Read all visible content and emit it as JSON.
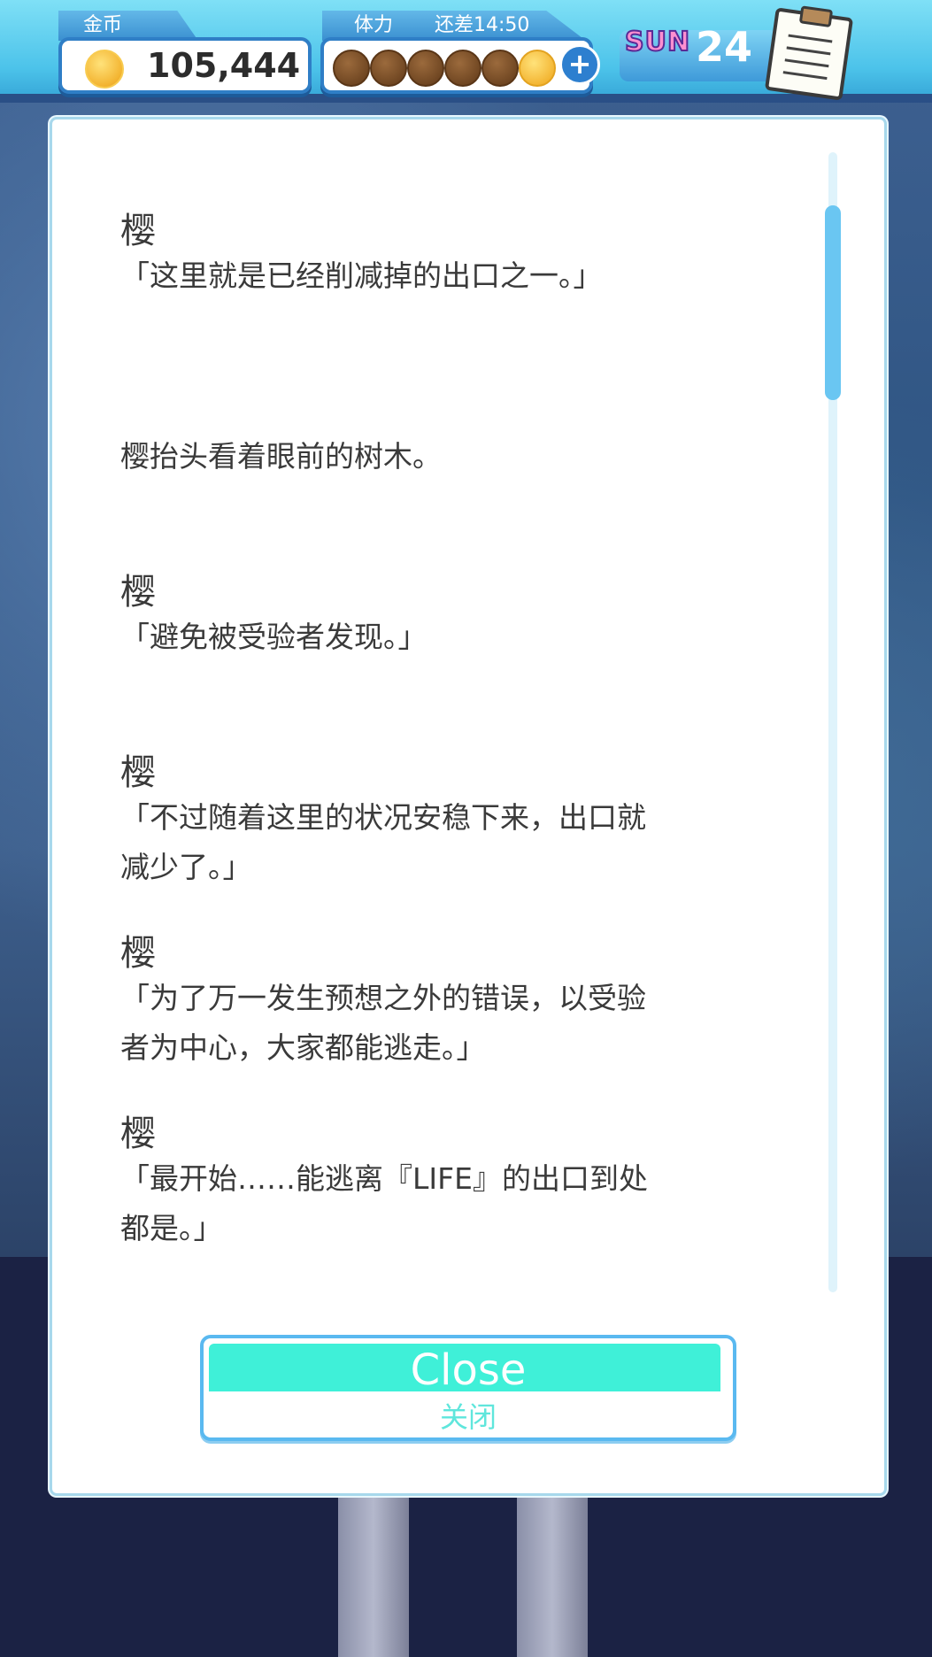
{
  "hud": {
    "coins": {
      "label": "金币",
      "value": "105,444"
    },
    "stamina": {
      "label": "体力",
      "timer": "还差14:50",
      "current": 1,
      "max": 6,
      "add_label": "+"
    },
    "calendar": {
      "day_name": "SUN",
      "day_number": "24"
    },
    "icons": {
      "coin": "coin-icon",
      "stamina": "stamina-face-icon",
      "notes": "notepad-icon"
    }
  },
  "log": {
    "entries": [
      {
        "speaker": "樱",
        "lines": [
          "「这里就是已经削减掉的出口之一。」"
        ]
      },
      {
        "speaker": "",
        "lines": [
          "樱抬头看着眼前的树木。"
        ]
      },
      {
        "speaker": "樱",
        "lines": [
          "「避免被受验者发现。」"
        ]
      },
      {
        "speaker": "樱",
        "lines": [
          "「不过随着这里的状况安稳下来，出口就",
          "减少了。」"
        ]
      },
      {
        "speaker": "樱",
        "lines": [
          "「为了万一发生预想之外的错误，以受验",
          "者为中心，大家都能逃走。」"
        ]
      },
      {
        "speaker": "樱",
        "lines": [
          "「最开始……能逃离『LIFE』的出口到处",
          "都是。」"
        ]
      }
    ],
    "scroll_position": 0.07
  },
  "close_button": {
    "label": "Close",
    "sublabel": "关闭"
  },
  "colors": {
    "accent": "#4cc3ea",
    "close_top": "#3ff0d8",
    "scroll_thumb": "#6ac6f2"
  }
}
